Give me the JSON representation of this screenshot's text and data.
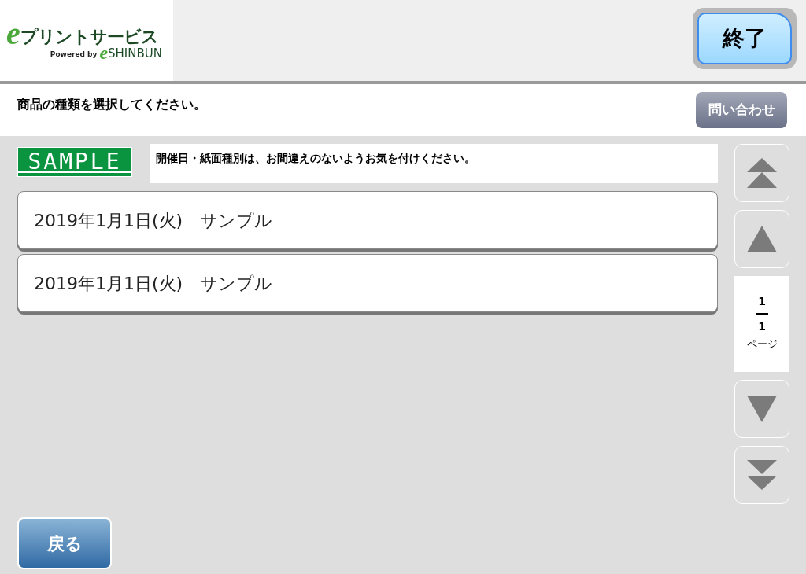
{
  "logo": {
    "mark": "e",
    "name": "プリントサービス",
    "powered_by": "Powered by",
    "brand_mark": "e",
    "brand": "SHINBUN"
  },
  "end_button": "終了",
  "instruction": "商品の種類を選択してください。",
  "contact_button": "問い合わせ",
  "sample_badge": "SAMPLE",
  "notice": "開催日・紙面種別は、お間違えのないようお気を付けください。",
  "items": [
    {
      "label": "2019年1月1日(火)　サンプル"
    },
    {
      "label": "2019年1月1日(火)　サンプル"
    }
  ],
  "pager": {
    "buttons": [
      {
        "kind": "first"
      },
      {
        "kind": "prev"
      },
      {
        "kind": "next"
      },
      {
        "kind": "last"
      }
    ],
    "current": "1",
    "total": "1",
    "unit": "ページ"
  },
  "back_button": "戻る"
}
